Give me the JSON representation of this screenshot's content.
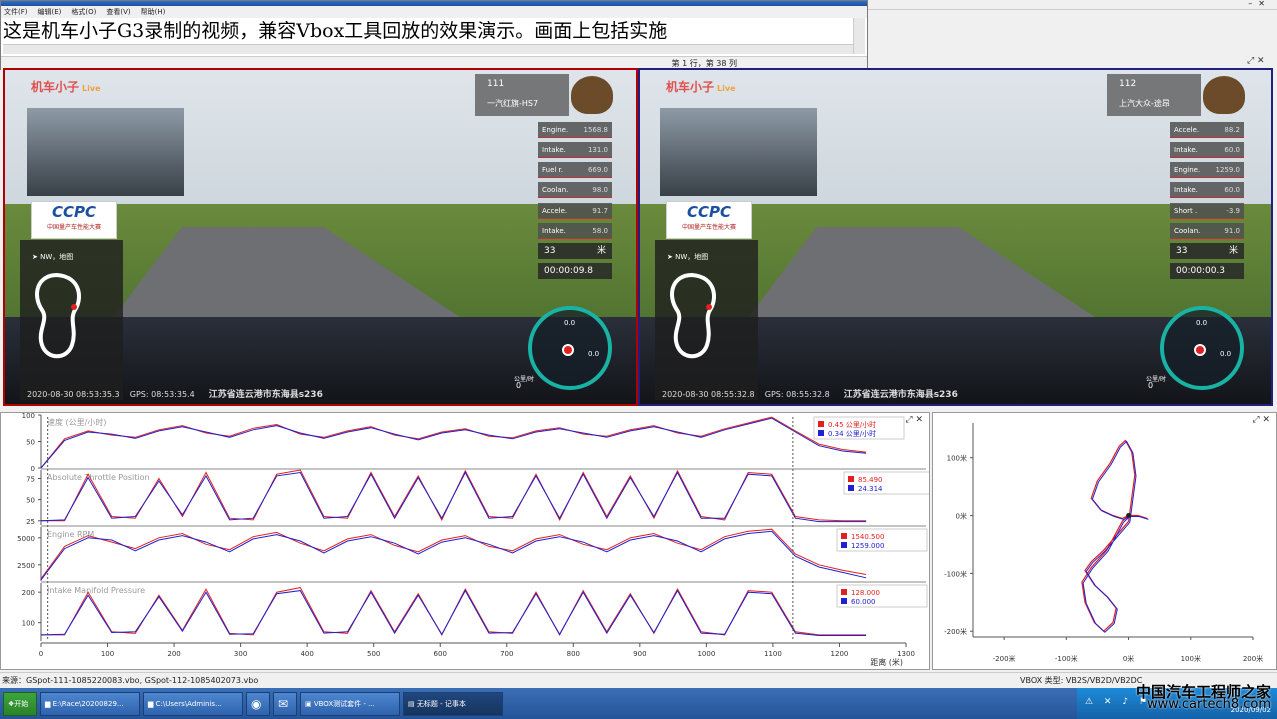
{
  "notepad": {
    "menu": [
      "文件(F)",
      "编辑(E)",
      "格式(O)",
      "查看(V)",
      "帮助(H)"
    ],
    "text": "这是机车小子G3录制的视频，兼容Vbox工具回放的效果演示。画面上包括实施",
    "status": "第 1 行，第 38 列"
  },
  "videos": [
    {
      "logo": "机车小子",
      "logo_live": "Live",
      "car_number": "111",
      "car_name": "一汽红旗-HS7",
      "params": [
        {
          "label": "Engine.",
          "value": "1568.8"
        },
        {
          "label": "Intake.",
          "value": "131.0"
        },
        {
          "label": "Fuel r.",
          "value": "669.0"
        },
        {
          "label": "Coolan.",
          "value": "98.0"
        },
        {
          "label": "Accele.",
          "value": "91.7"
        },
        {
          "label": "Intake.",
          "value": "58.0"
        }
      ],
      "lap_count": "33",
      "lap_unit": "米",
      "timer": "00:00:09.8",
      "ccpc_title": "CCPC",
      "ccpc_subtitle": "中国量产车性能大赛",
      "nav": "NW，地图",
      "gauge_v1": "0.0",
      "gauge_v2": "0.0",
      "speed_unit": "公里/时",
      "speed_value": "0",
      "date": "2020-08-30  08:53:35.3",
      "gps": "GPS:  08:53:35.4",
      "location": "江苏省连云港市东海县s236"
    },
    {
      "logo": "机车小子",
      "logo_live": "Live",
      "car_number": "112",
      "car_name": "上汽大众-途昂",
      "params": [
        {
          "label": "Accele.",
          "value": "88.2"
        },
        {
          "label": "Intake.",
          "value": "60.0"
        },
        {
          "label": "Engine.",
          "value": "1259.0"
        },
        {
          "label": "Intake.",
          "value": "60.0"
        },
        {
          "label": "Short .",
          "value": "-3.9"
        },
        {
          "label": "Coolan.",
          "value": "91.0"
        }
      ],
      "lap_count": "33",
      "lap_unit": "米",
      "timer": "00:00:00.3",
      "ccpc_title": "CCPC",
      "ccpc_subtitle": "中国量产车性能大赛",
      "nav": "NW，地图",
      "gauge_v1": "0.0",
      "gauge_v2": "0.0",
      "speed_unit": "公里/时",
      "speed_value": "0",
      "date": "2020-08-30  08:55:32.8",
      "gps": "GPS:  08:55:32.8",
      "location": "江苏省连云港市东海县s236"
    }
  ],
  "chart_data": [
    {
      "type": "line",
      "title": "速度 (公里/小时)",
      "ylim": [
        0,
        100
      ],
      "yticks": [
        0,
        50,
        100
      ],
      "xlim": [
        0,
        1300
      ],
      "legend": [
        "0.45 公里/小时",
        "0.34 公里/小时"
      ],
      "series": [
        {
          "values": [
            0,
            55,
            70,
            62,
            58,
            72,
            80,
            66,
            60,
            75,
            82,
            64,
            58,
            70,
            78,
            62,
            55,
            68,
            74,
            60,
            57,
            70,
            76,
            64,
            60,
            72,
            80,
            66,
            60,
            74,
            85,
            96,
            70,
            45,
            35,
            30
          ]
        },
        {
          "values": [
            0,
            52,
            68,
            64,
            56,
            70,
            78,
            68,
            58,
            72,
            80,
            66,
            56,
            68,
            76,
            64,
            53,
            66,
            72,
            62,
            55,
            68,
            74,
            66,
            58,
            70,
            78,
            68,
            58,
            72,
            83,
            94,
            68,
            42,
            32,
            28
          ]
        }
      ]
    },
    {
      "type": "line",
      "title": "Absolute Throttle Position",
      "ylim": [
        20,
        85
      ],
      "yticks": [
        25,
        50,
        75
      ],
      "xlim": [
        0,
        1300
      ],
      "legend": [
        "85.490",
        "24.314"
      ],
      "series": [
        {
          "values": [
            25,
            25,
            80,
            30,
            28,
            75,
            30,
            82,
            28,
            26,
            80,
            85,
            30,
            28,
            82,
            30,
            78,
            26,
            84,
            30,
            28,
            80,
            26,
            82,
            30,
            78,
            28,
            84,
            30,
            26,
            82,
            80,
            30,
            26,
            25,
            25
          ]
        },
        {
          "values": [
            25,
            26,
            76,
            28,
            30,
            72,
            32,
            78,
            26,
            28,
            78,
            82,
            28,
            30,
            80,
            28,
            76,
            28,
            82,
            28,
            30,
            78,
            28,
            80,
            28,
            76,
            30,
            82,
            28,
            28,
            80,
            78,
            28,
            24,
            24,
            24
          ]
        }
      ]
    },
    {
      "type": "line",
      "title": "Engine RPM",
      "ylim": [
        1000,
        6000
      ],
      "yticks": [
        2500,
        5000
      ],
      "xlim": [
        0,
        1300
      ],
      "legend": [
        "1540.500",
        "1259.000"
      ],
      "series": [
        {
          "values": [
            1200,
            4200,
            5200,
            4600,
            4000,
            5000,
            5400,
            4400,
            3900,
            5100,
            5500,
            4500,
            3800,
            4900,
            5300,
            4300,
            3700,
            4800,
            5200,
            4200,
            3800,
            4900,
            5300,
            4400,
            3900,
            5000,
            5400,
            4500,
            3900,
            5100,
            5600,
            5800,
            3500,
            2500,
            2000,
            1600
          ]
        },
        {
          "values": [
            1100,
            4000,
            5000,
            4800,
            3800,
            4800,
            5200,
            4600,
            3700,
            4900,
            5300,
            4700,
            3600,
            4700,
            5100,
            4500,
            3500,
            4600,
            5000,
            4400,
            3600,
            4700,
            5100,
            4600,
            3700,
            4800,
            5200,
            4700,
            3700,
            4900,
            5400,
            5600,
            3300,
            2300,
            1800,
            1300
          ]
        }
      ]
    },
    {
      "type": "line",
      "title": "Intake Manifold Pressure",
      "ylim": [
        40,
        230
      ],
      "yticks": [
        100,
        200
      ],
      "xlim": [
        0,
        1300
      ],
      "xticks": [
        0,
        100,
        200,
        300,
        400,
        500,
        600,
        700,
        800,
        900,
        1000,
        1100,
        1200,
        1300
      ],
      "xlabel": "距离 (米)",
      "legend": [
        "128.000",
        "60.000"
      ],
      "series": [
        {
          "values": [
            60,
            60,
            200,
            70,
            65,
            190,
            75,
            210,
            65,
            60,
            200,
            215,
            70,
            65,
            205,
            70,
            195,
            60,
            210,
            70,
            65,
            200,
            60,
            205,
            70,
            195,
            65,
            210,
            70,
            60,
            205,
            200,
            70,
            60,
            60,
            60
          ]
        },
        {
          "values": [
            60,
            62,
            190,
            68,
            70,
            185,
            72,
            200,
            62,
            64,
            195,
            205,
            66,
            70,
            200,
            66,
            190,
            62,
            205,
            66,
            68,
            195,
            62,
            200,
            66,
            190,
            68,
            205,
            66,
            62,
            200,
            195,
            66,
            58,
            58,
            58
          ]
        }
      ]
    },
    {
      "type": "line",
      "title": "",
      "xlim": [
        -250,
        200
      ],
      "ylim": [
        -210,
        160
      ],
      "xticks": [
        -200,
        -100,
        0,
        100,
        200
      ],
      "yticks": [
        -200,
        -100,
        0,
        100
      ],
      "tick_suffix": "米",
      "series": [
        {
          "x": [
            0,
            -10,
            -35,
            -60,
            -75,
            -70,
            -55,
            -40,
            -25,
            -20,
            -35,
            -55,
            -70,
            -60,
            -40,
            -20,
            0,
            5,
            10,
            5,
            -5,
            -15,
            -30,
            -50,
            -60,
            -45,
            -25,
            -10,
            0,
            15,
            30
          ],
          "y": [
            0,
            -10,
            -60,
            -90,
            -115,
            -150,
            -185,
            -200,
            -185,
            -160,
            -140,
            -120,
            -95,
            -80,
            -60,
            -35,
            -10,
            30,
            70,
            110,
            130,
            120,
            90,
            60,
            30,
            10,
            0,
            -5,
            0,
            0,
            -5
          ]
        }
      ]
    }
  ],
  "statusbar": {
    "left": "来源：GSpot-111-1085220083.vbo, GSpot-112-1085402073.vbo",
    "right": "VBOX 类型: VB2S/VB2D/VB2DC"
  },
  "taskbar": {
    "start": "开始",
    "buttons": [
      "E:\\Race\\20200829...",
      "C:\\Users\\Adminis...",
      "VBOX测试套件 - ...",
      "无标题 - 记事本"
    ],
    "clock": "2020/09/02"
  },
  "watermark": {
    "line1": "中国汽车工程师之家",
    "line2": "www.cartech8.com"
  },
  "colors": {
    "series_red": "#e02020",
    "series_blue": "#2020d0",
    "video_border_left": "#b00000",
    "video_border_right": "#202080"
  }
}
